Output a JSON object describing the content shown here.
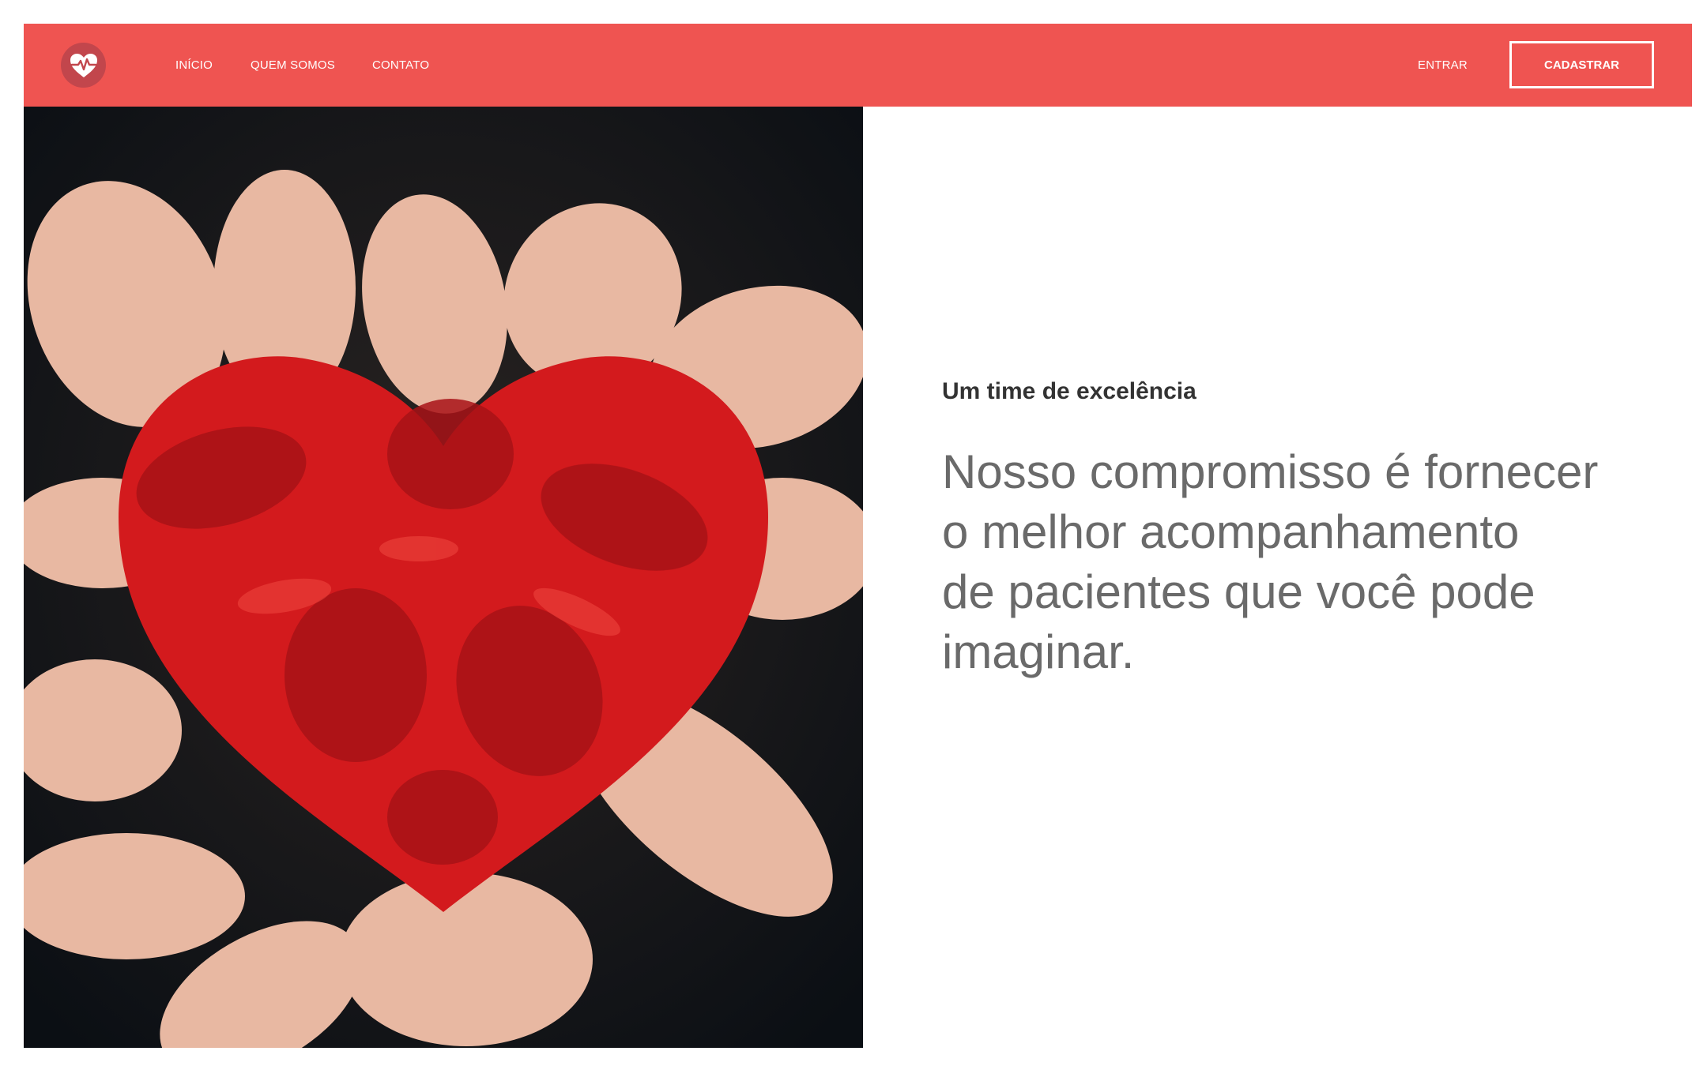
{
  "header": {
    "logo_icon": "heart-pulse-icon",
    "nav": {
      "inicio": "INÍCIO",
      "quem_somos": "QUEM SOMOS",
      "contato": "CONTATO"
    },
    "login_label": "ENTRAR",
    "signup_label": "CADASTRAR"
  },
  "hero": {
    "image_icon": "red-painted-hands-heart-photo",
    "subtitle": "Um time de excelência",
    "headline_lines": [
      "Nosso compromisso é fornecer",
      "o melhor acompanhamento",
      "de pacientes que você pode",
      "imaginar."
    ]
  },
  "colors": {
    "brand": "#ef5451",
    "logo_circle": "#c2464c",
    "headline_text": "#6a6a6a",
    "subtitle_text": "#333333"
  }
}
